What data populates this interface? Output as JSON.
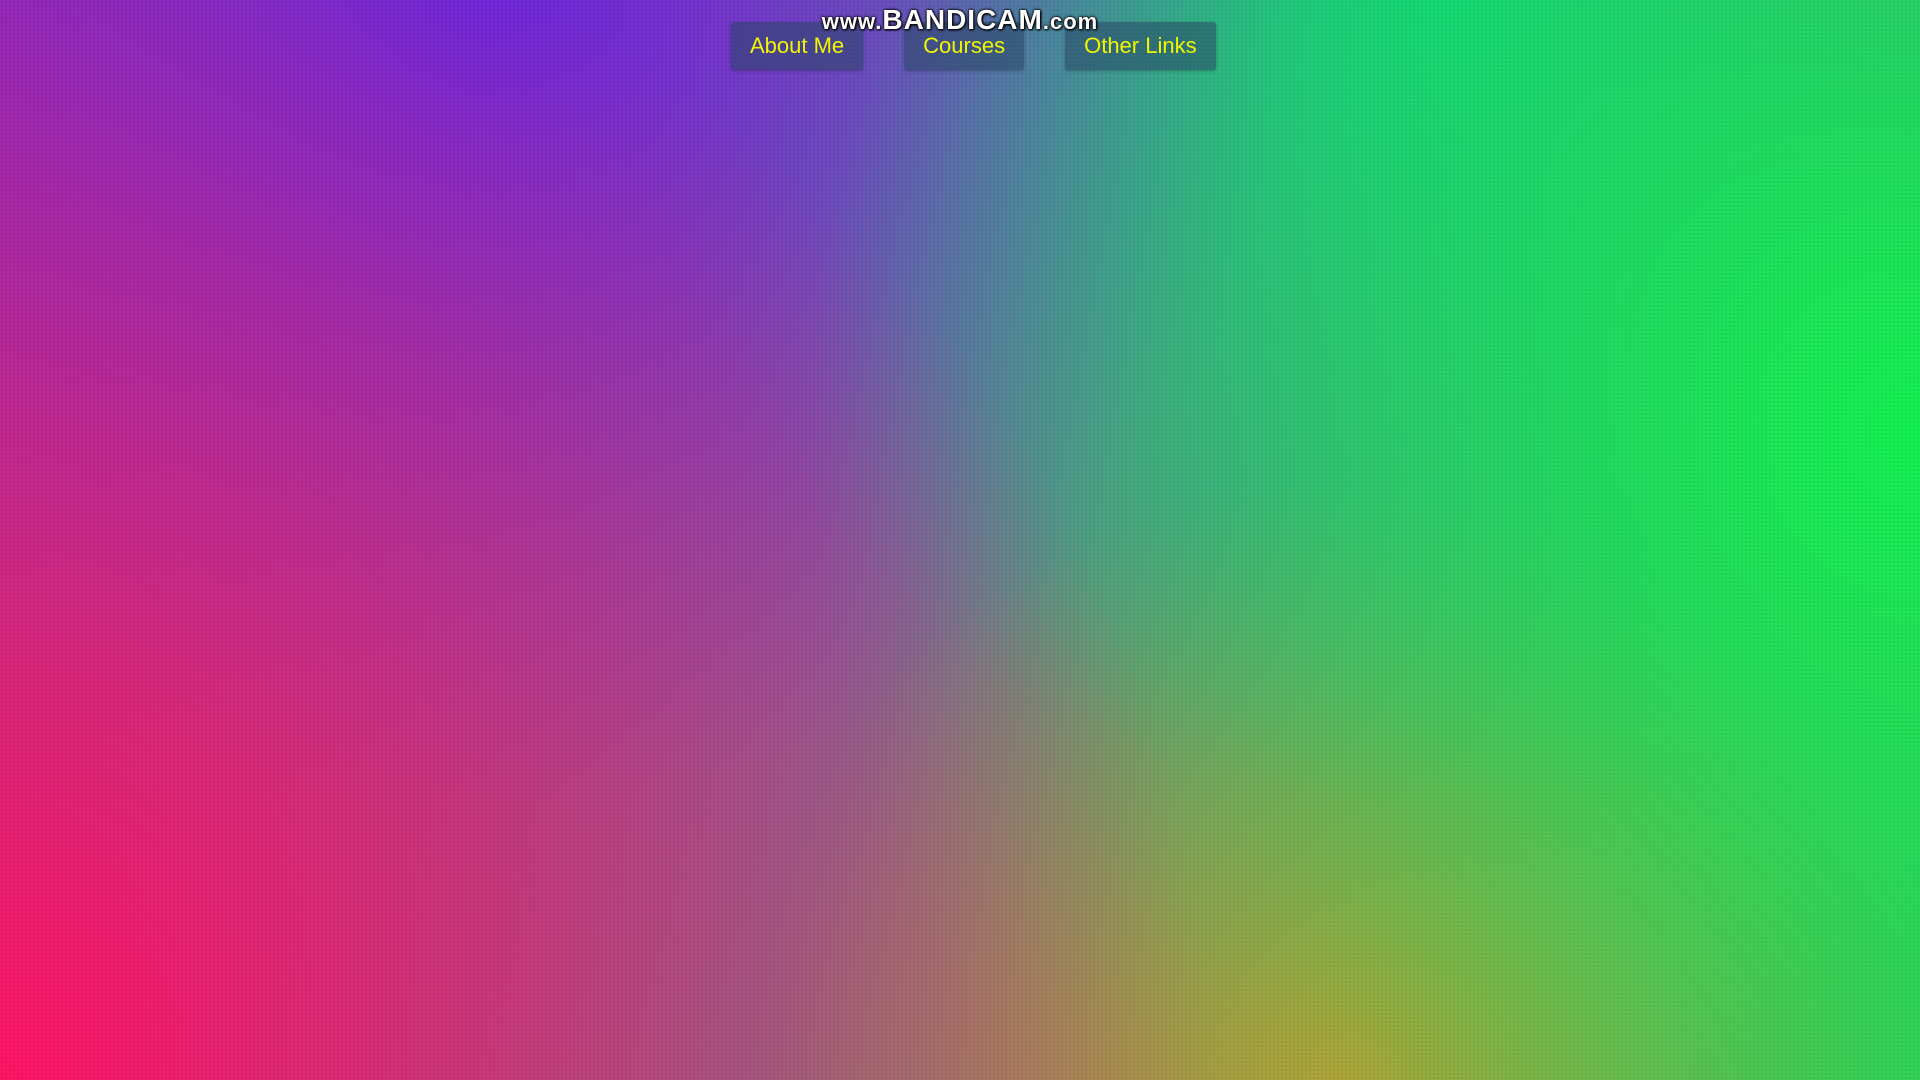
{
  "watermark": {
    "prefix": "www.",
    "brand": "BANDICAM",
    "suffix": ".com"
  },
  "nav": {
    "items": [
      {
        "label": "About Me"
      },
      {
        "label": "Courses"
      },
      {
        "label": "Other Links"
      }
    ]
  },
  "colors": {
    "nav_text": "#f2f500",
    "nav_bg": "rgba(40,70,100,0.55)",
    "gradient_pink": "#ff1464",
    "gradient_purple": "#6e28dc",
    "gradient_teal": "#14c88c",
    "gradient_green": "#14f050",
    "gradient_orange": "#e68c28"
  }
}
